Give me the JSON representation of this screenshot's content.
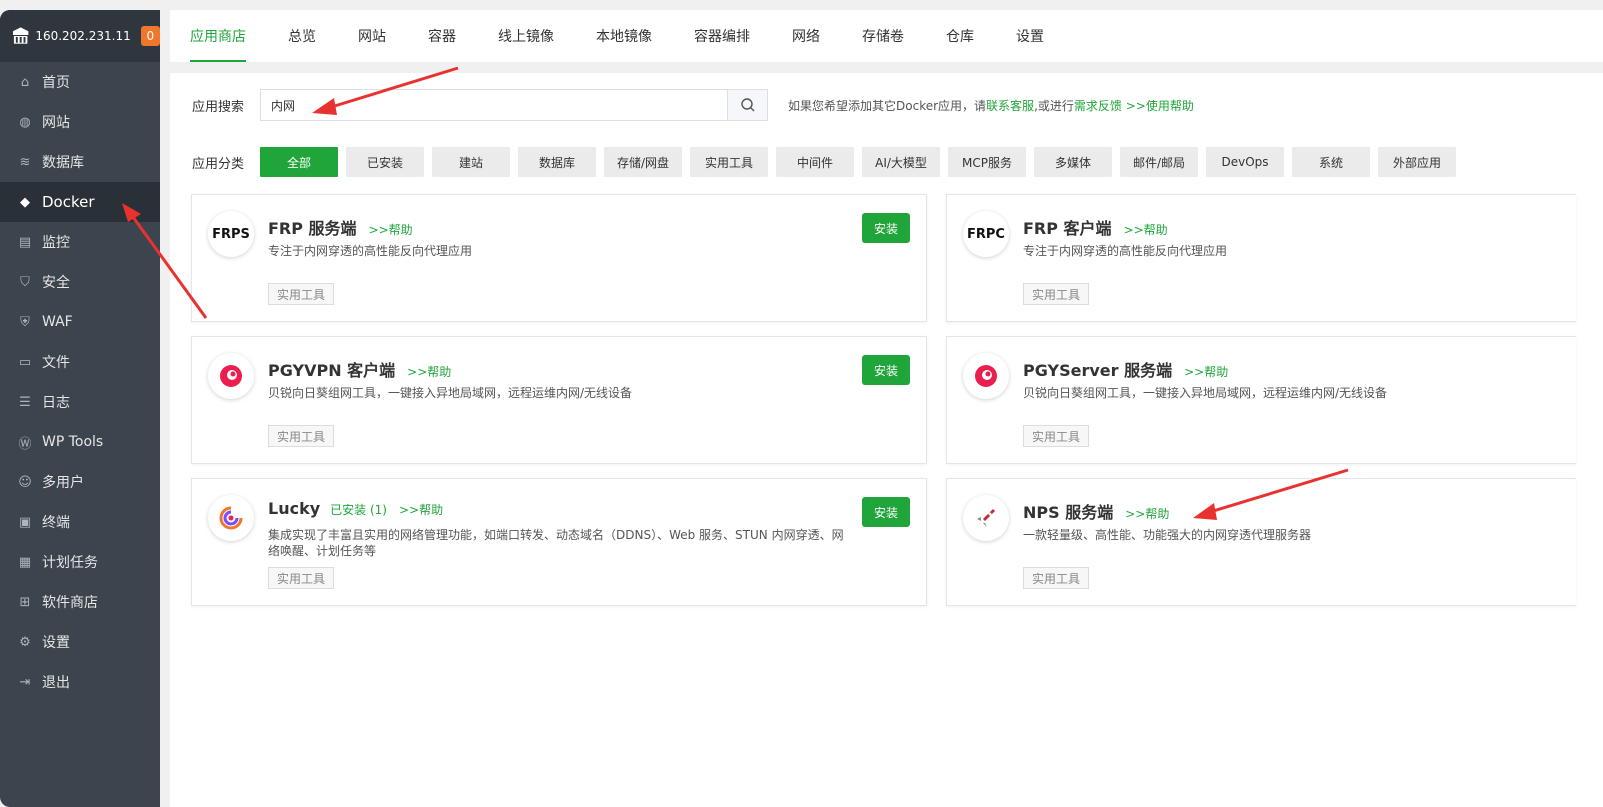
{
  "sidebar": {
    "ip": "160.202.231.11",
    "badge": "0",
    "items": [
      {
        "label": "首页",
        "icon": "home-icon"
      },
      {
        "label": "网站",
        "icon": "globe-icon"
      },
      {
        "label": "数据库",
        "icon": "database-icon"
      },
      {
        "label": "Docker",
        "icon": "docker-icon"
      },
      {
        "label": "监控",
        "icon": "monitor-icon"
      },
      {
        "label": "安全",
        "icon": "shield-icon"
      },
      {
        "label": "WAF",
        "icon": "waf-icon"
      },
      {
        "label": "文件",
        "icon": "folder-icon"
      },
      {
        "label": "日志",
        "icon": "log-icon"
      },
      {
        "label": "WP Tools",
        "icon": "wordpress-icon"
      },
      {
        "label": "多用户",
        "icon": "users-icon"
      },
      {
        "label": "终端",
        "icon": "terminal-icon"
      },
      {
        "label": "计划任务",
        "icon": "calendar-icon"
      },
      {
        "label": "软件商店",
        "icon": "grid-icon"
      },
      {
        "label": "设置",
        "icon": "gear-icon"
      },
      {
        "label": "退出",
        "icon": "logout-icon"
      }
    ],
    "active_index": 3
  },
  "tabs": [
    "应用商店",
    "总览",
    "网站",
    "容器",
    "线上镜像",
    "本地镜像",
    "容器编排",
    "网络",
    "存储卷",
    "仓库",
    "设置"
  ],
  "search": {
    "label": "应用搜索",
    "value": "内网",
    "hint_prefix": "如果您希望添加其它Docker应用，请",
    "hint_link1": "联系客服",
    "hint_mid": ",或进行",
    "hint_link2": "需求反馈",
    "hint_link3": " >>使用帮助"
  },
  "categories": {
    "label": "应用分类",
    "items": [
      "全部",
      "已安装",
      "建站",
      "数据库",
      "存储/网盘",
      "实用工具",
      "中间件",
      "AI/大模型",
      "MCP服务",
      "多媒体",
      "邮件/邮局",
      "DevOps",
      "系统",
      "外部应用"
    ]
  },
  "apps": [
    {
      "name": "FRP 服务端",
      "icon_text": "FRPS",
      "installed": "",
      "help": ">>帮助",
      "desc": "专注于内网穿透的高性能反向代理应用",
      "tag": "实用工具",
      "install": "安装"
    },
    {
      "name": "FRP 客户端",
      "icon_text": "FRPC",
      "installed": "",
      "help": ">>帮助",
      "desc": "专注于内网穿透的高性能反向代理应用",
      "tag": "实用工具",
      "install": ""
    },
    {
      "name": "PGYVPN 客户端",
      "icon_text": "",
      "installed": "",
      "help": ">>帮助",
      "desc": "贝锐向日葵组网工具，一键接入异地局域网，远程运维内网/无线设备",
      "tag": "实用工具",
      "install": "安装"
    },
    {
      "name": "PGYServer 服务端",
      "icon_text": "",
      "installed": "",
      "help": ">>帮助",
      "desc": "贝锐向日葵组网工具，一键接入异地局域网，远程运维内网/无线设备",
      "tag": "实用工具",
      "install": ""
    },
    {
      "name": "Lucky",
      "icon_text": "",
      "installed": "已安装 (1)",
      "help": ">>帮助",
      "desc": "集成实现了丰富且实用的网络管理功能，如端口转发、动态域名（DDNS）、Web 服务、STUN 内网穿透、网络唤醒、计划任务等",
      "tag": "实用工具",
      "install": "安装"
    },
    {
      "name": "NPS 服务端",
      "icon_text": "",
      "installed": "",
      "help": ">>帮助",
      "desc": "一款轻量级、高性能、功能强大的内网穿透代理服务器",
      "tag": "实用工具",
      "install": ""
    }
  ],
  "colors": {
    "accent": "#20a53a",
    "sidebar_bg": "#3c444d",
    "badge": "#f0762c",
    "arrow": "#e8322f"
  }
}
